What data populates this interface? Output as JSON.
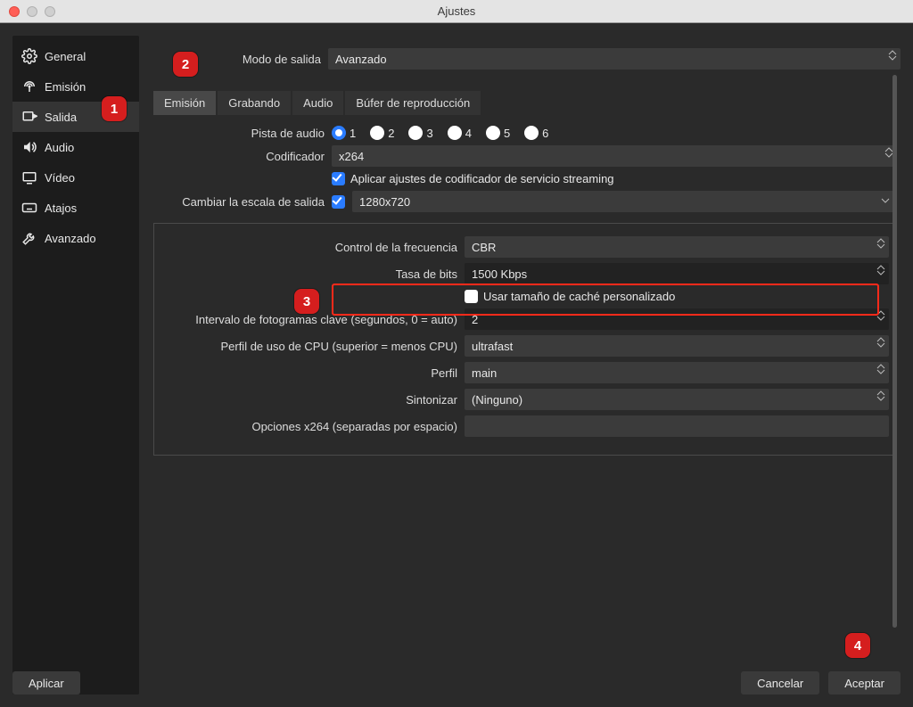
{
  "window": {
    "title": "Ajustes"
  },
  "sidebar": {
    "items": [
      {
        "label": "General"
      },
      {
        "label": "Emisión"
      },
      {
        "label": "Salida"
      },
      {
        "label": "Audio"
      },
      {
        "label": "Vídeo"
      },
      {
        "label": "Atajos"
      },
      {
        "label": "Avanzado"
      }
    ]
  },
  "output_mode": {
    "label": "Modo de salida",
    "value": "Avanzado"
  },
  "tabs": [
    {
      "label": "Emisión"
    },
    {
      "label": "Grabando"
    },
    {
      "label": "Audio"
    },
    {
      "label": "Búfer de reproducción"
    }
  ],
  "stream": {
    "audio_track_label": "Pista de audio",
    "tracks": [
      "1",
      "2",
      "3",
      "4",
      "5",
      "6"
    ],
    "encoder_label": "Codificador",
    "encoder_value": "x264",
    "enforce_label": "Aplicar ajustes de codificador de servicio streaming",
    "rescale_label": "Cambiar la escala de salida",
    "rescale_value": "1280x720"
  },
  "encoder_panel": {
    "rate_control_label": "Control de la frecuencia",
    "rate_control_value": "CBR",
    "bitrate_label": "Tasa de bits",
    "bitrate_value": "1500 Kbps",
    "custom_buffer_label": "Usar tamaño de caché personalizado",
    "keyint_label": "Intervalo de fotogramas clave (segundos, 0 = auto)",
    "keyint_value": "2",
    "cpu_preset_label": "Perfil de uso de CPU (superior = menos CPU)",
    "cpu_preset_value": "ultrafast",
    "profile_label": "Perfil",
    "profile_value": "main",
    "tune_label": "Sintonizar",
    "tune_value": "(Ninguno)",
    "x264opts_label": "Opciones x264 (separadas por espacio)",
    "x264opts_value": ""
  },
  "buttons": {
    "apply": "Aplicar",
    "cancel": "Cancelar",
    "ok": "Aceptar"
  },
  "badges": [
    "1",
    "2",
    "3",
    "4"
  ]
}
